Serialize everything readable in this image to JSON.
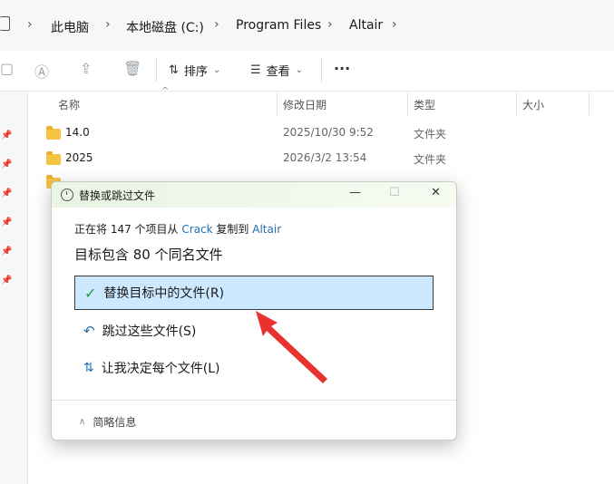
{
  "address": {
    "crumbs": [
      "此电脑",
      "本地磁盘 (C:)",
      "Program Files",
      "Altair"
    ]
  },
  "toolbar": {
    "sort_label": "排序",
    "view_label": "查看",
    "more_label": "···"
  },
  "columns": {
    "name": "名称",
    "modified": "修改日期",
    "type": "类型",
    "size": "大小"
  },
  "files": [
    {
      "name": "14.0",
      "modified": "2025/10/30 9:52",
      "type": "文件夹"
    },
    {
      "name": "2025",
      "modified": "2026/3/2 13:54",
      "type": "文件夹"
    }
  ],
  "dialog": {
    "title": "替换或跳过文件",
    "info_prefix": "正在将 147 个项目从",
    "info_source": "Crack",
    "info_middle": "复制到",
    "info_dest": "Altair",
    "heading": "目标包含 80 个同名文件",
    "option_replace": "替换目标中的文件(R)",
    "option_skip": "跳过这些文件(S)",
    "option_decide": "让我决定每个文件(L)",
    "footer_label": "简略信息"
  },
  "colors": {
    "selected_bg": "#cce8ff",
    "accent": "#1f6fb2",
    "arrow": "#e8322e",
    "check": "#1b9a3b"
  }
}
